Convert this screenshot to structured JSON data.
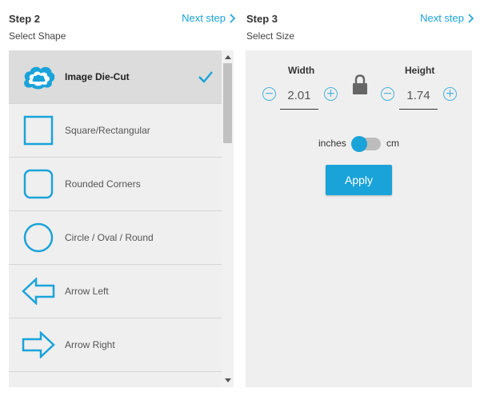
{
  "colors": {
    "accent": "#1aa3d9",
    "panel_bg": "#efefef",
    "selected_bg": "#dcdcdc"
  },
  "left": {
    "step_title": "Step 2",
    "step_subtitle": "Select Shape",
    "next_label": "Next step",
    "shapes": [
      {
        "label": "Image Die-Cut",
        "icon": "cloud-shape-icon",
        "selected": true
      },
      {
        "label": "Square/Rectangular",
        "icon": "square-shape-icon",
        "selected": false
      },
      {
        "label": "Rounded Corners",
        "icon": "rounded-square-shape-icon",
        "selected": false
      },
      {
        "label": "Circle / Oval / Round",
        "icon": "circle-shape-icon",
        "selected": false
      },
      {
        "label": "Arrow Left",
        "icon": "arrow-left-shape-icon",
        "selected": false
      },
      {
        "label": "Arrow Right",
        "icon": "arrow-right-shape-icon",
        "selected": false
      }
    ]
  },
  "right": {
    "step_title": "Step 3",
    "step_subtitle": "Select Size",
    "next_label": "Next step",
    "width_label": "Width",
    "height_label": "Height",
    "width_value": "2.01",
    "height_value": "1.74",
    "unit_left": "inches",
    "unit_right": "cm",
    "apply_label": "Apply"
  }
}
